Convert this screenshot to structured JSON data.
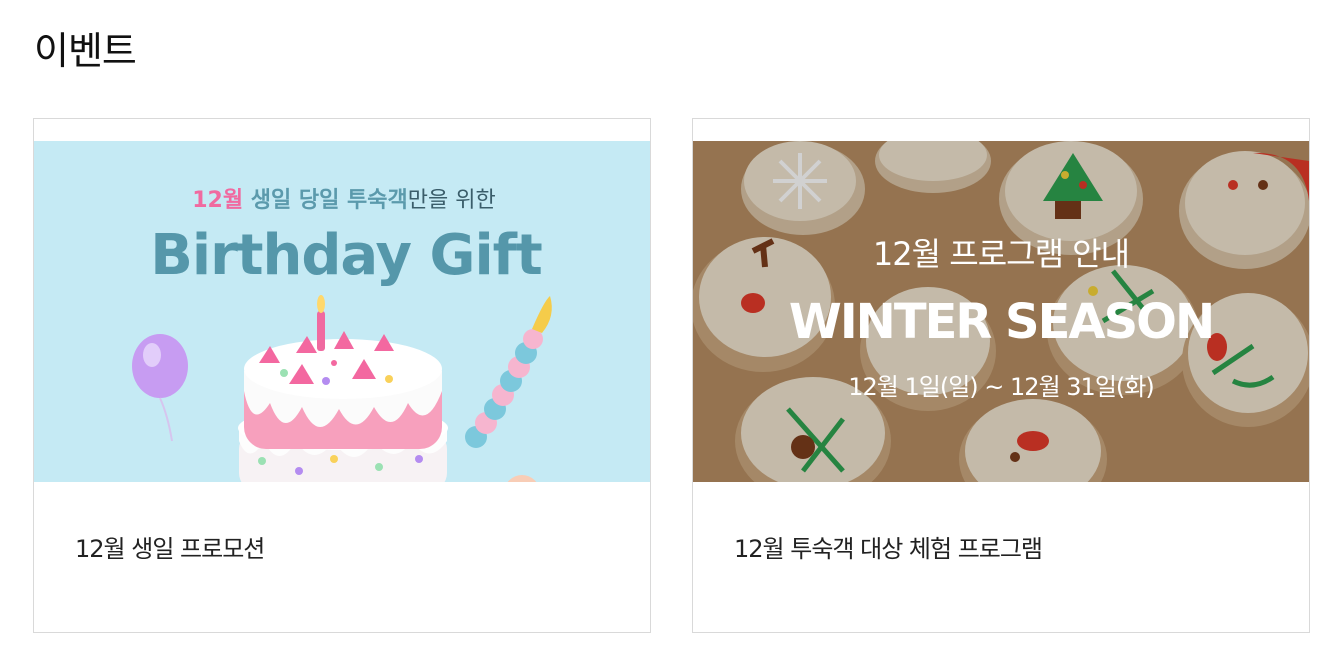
{
  "page": {
    "title": "이벤트"
  },
  "events": [
    {
      "caption": "12월 생일 프로모션",
      "banner": {
        "month": "12월",
        "headline_rest": " 생일 당일 투숙객",
        "headline_tail": "만을 위한",
        "title": "Birthday Gift",
        "colors": {
          "bg": "#c5eaf4",
          "month": "#f06aa0",
          "headline": "#5b9aac",
          "tail": "#3a5d6a",
          "title": "#5597aa"
        }
      }
    },
    {
      "caption": "12월 투숙객 대상 체험 프로그램",
      "banner": {
        "heading": "12월 프로그램 안내",
        "title": "WINTER SEASON",
        "dates": "12월 1일(일) ~ 12월 31일(화)",
        "colors": {
          "bg": "#b68d62",
          "text": "#ffffff"
        }
      }
    }
  ]
}
